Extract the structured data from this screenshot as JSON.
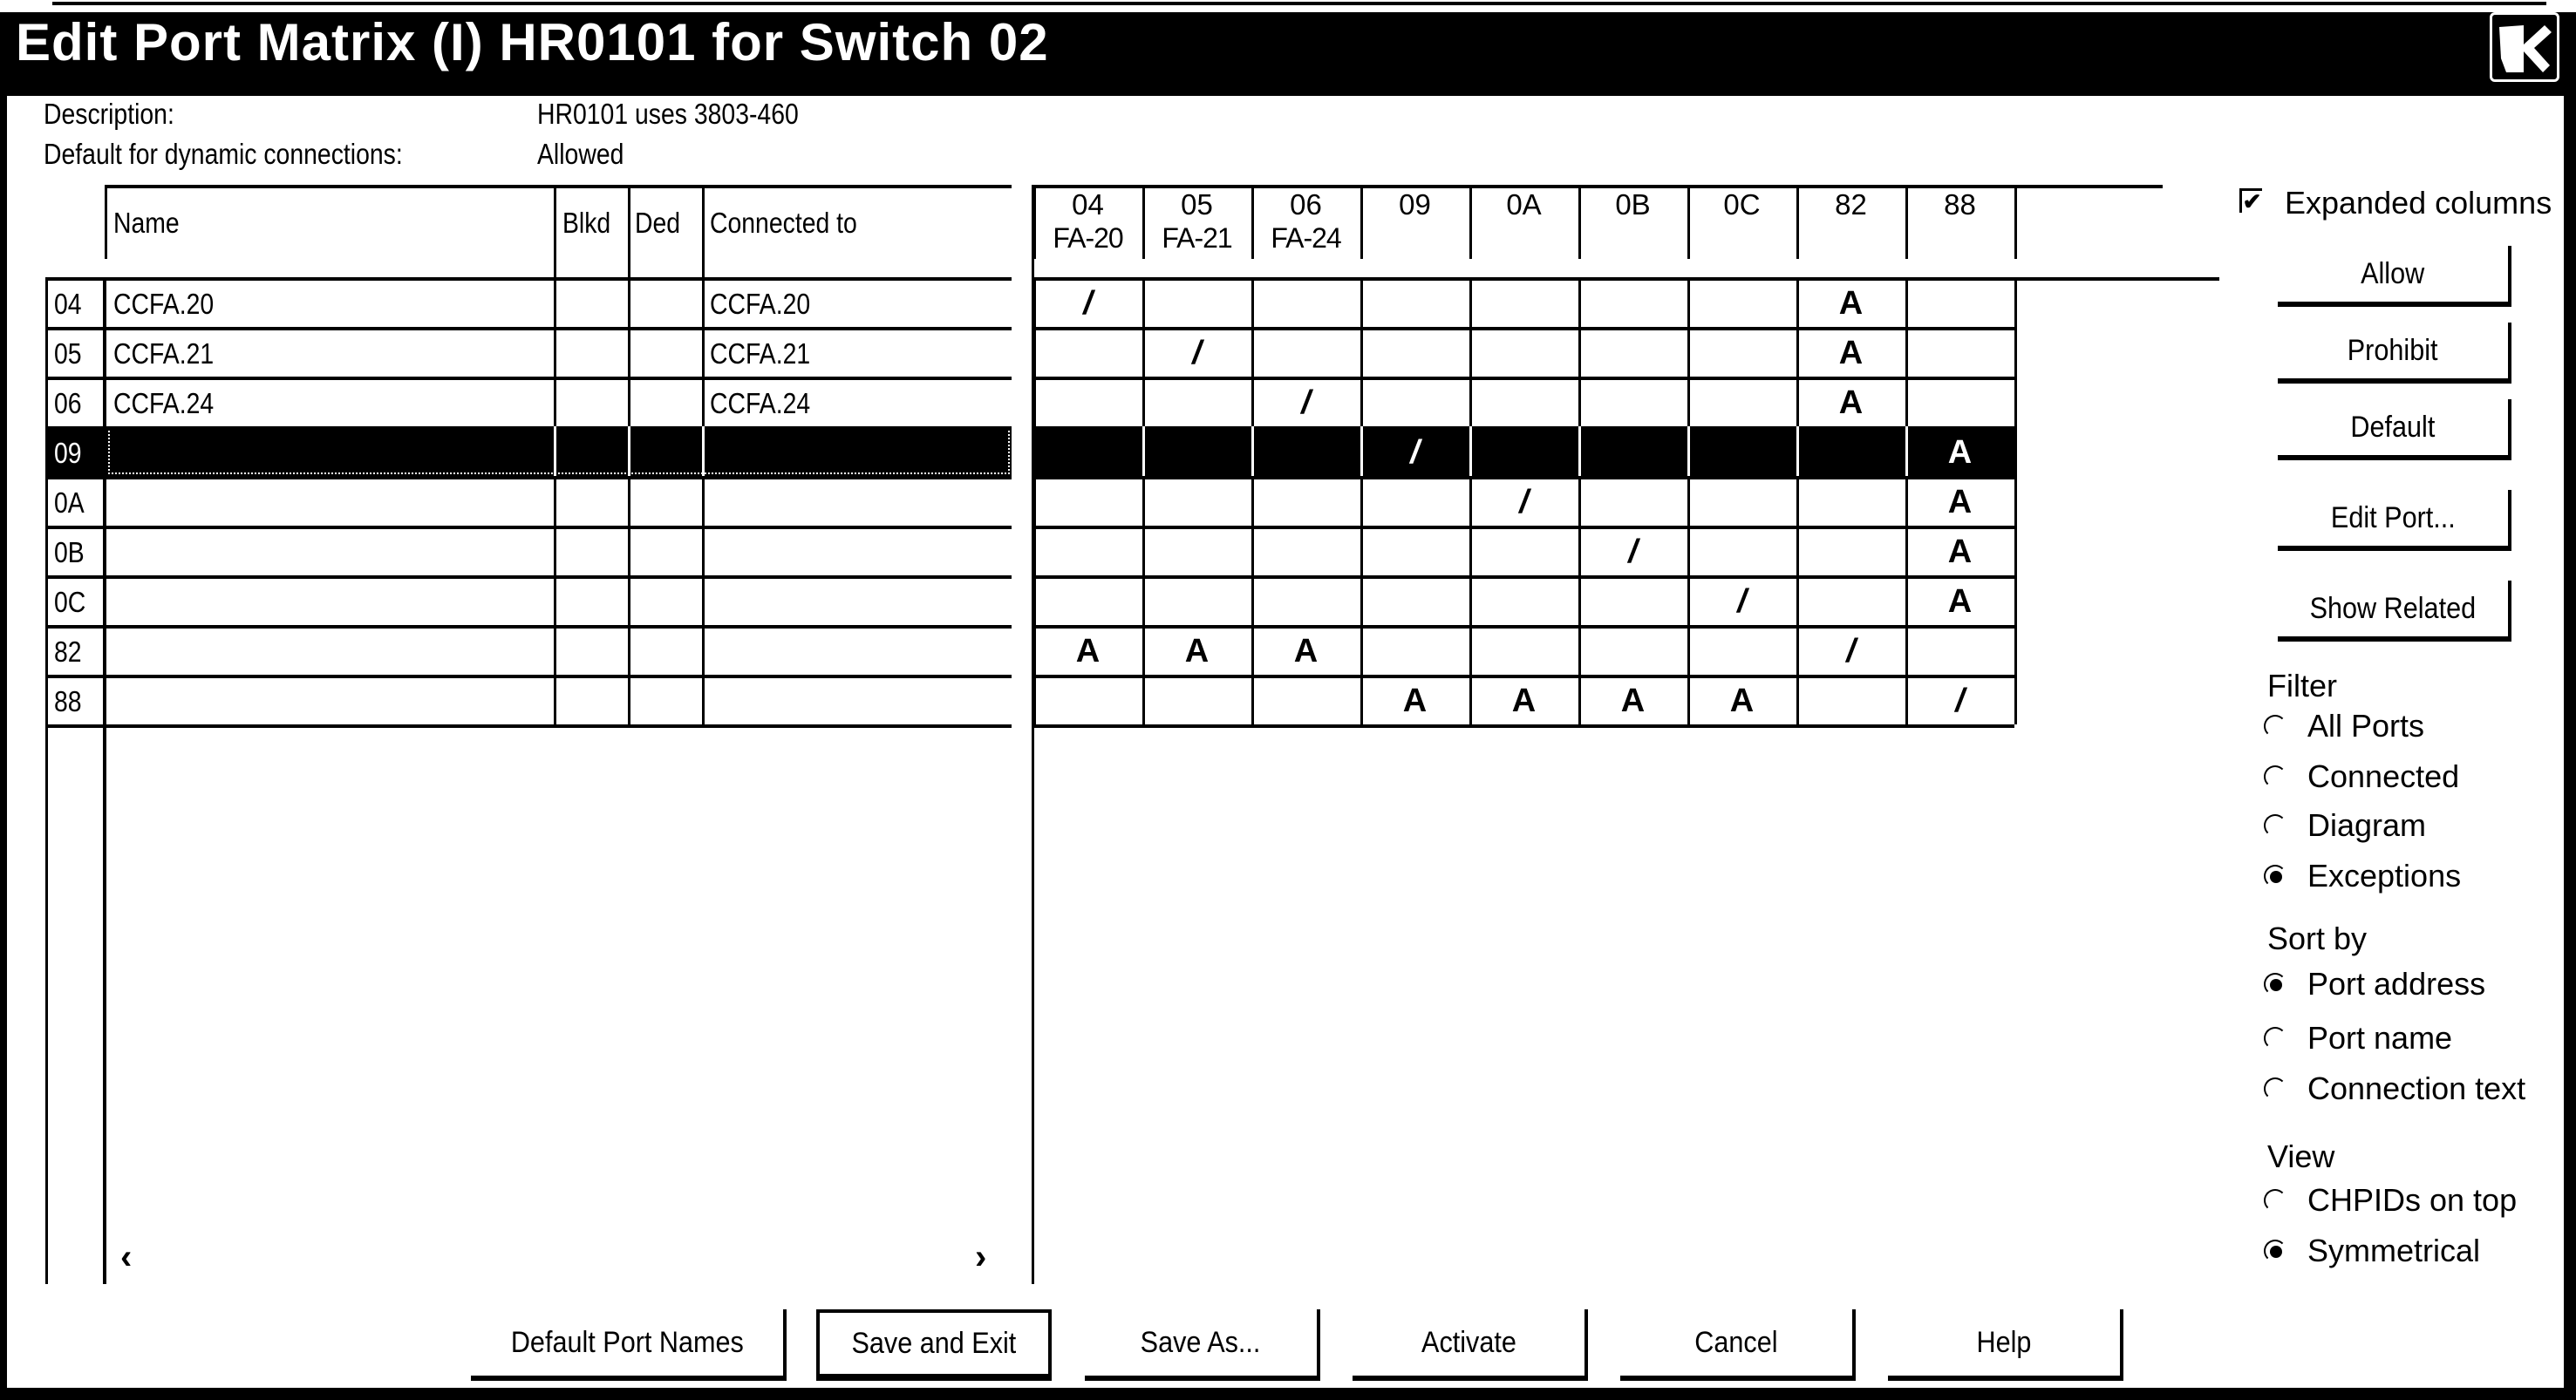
{
  "window": {
    "title": "Edit Port Matrix (I) HR0101 for Switch 02",
    "close_icon": "close-icon"
  },
  "info": {
    "description_label": "Description:",
    "description_value": "HR0101 uses 3803-460",
    "default_label": "Default for dynamic connections:",
    "default_value": "Allowed"
  },
  "port_table": {
    "columns": {
      "name": "Name",
      "blkd": "Blkd",
      "ded": "Ded",
      "connected": "Connected to"
    },
    "selected_row": "09",
    "rows": [
      {
        "addr": "04",
        "name": "CCFA.20",
        "blkd": "",
        "ded": "",
        "connected": "CCFA.20"
      },
      {
        "addr": "05",
        "name": "CCFA.21",
        "blkd": "",
        "ded": "",
        "connected": "CCFA.21"
      },
      {
        "addr": "06",
        "name": "CCFA.24",
        "blkd": "",
        "ded": "",
        "connected": "CCFA.24"
      },
      {
        "addr": "09",
        "name": "",
        "blkd": "",
        "ded": "",
        "connected": ""
      },
      {
        "addr": "0A",
        "name": "",
        "blkd": "",
        "ded": "",
        "connected": ""
      },
      {
        "addr": "0B",
        "name": "",
        "blkd": "",
        "ded": "",
        "connected": ""
      },
      {
        "addr": "0C",
        "name": "",
        "blkd": "",
        "ded": "",
        "connected": ""
      },
      {
        "addr": "82",
        "name": "",
        "blkd": "",
        "ded": "",
        "connected": ""
      },
      {
        "addr": "88",
        "name": "",
        "blkd": "",
        "ded": "",
        "connected": ""
      }
    ],
    "scroll_left": "‹",
    "scroll_right": "›"
  },
  "matrix": {
    "columns": [
      {
        "addr": "04",
        "sub": "FA-20"
      },
      {
        "addr": "05",
        "sub": "FA-21"
      },
      {
        "addr": "06",
        "sub": "FA-24"
      },
      {
        "addr": "09",
        "sub": ""
      },
      {
        "addr": "0A",
        "sub": ""
      },
      {
        "addr": "0B",
        "sub": ""
      },
      {
        "addr": "0C",
        "sub": ""
      },
      {
        "addr": "82",
        "sub": ""
      },
      {
        "addr": "88",
        "sub": ""
      }
    ],
    "cells": [
      [
        "/",
        "",
        "",
        "",
        "",
        "",
        "",
        "A",
        ""
      ],
      [
        "",
        "/",
        "",
        "",
        "",
        "",
        "",
        "A",
        ""
      ],
      [
        "",
        "",
        "/",
        "",
        "",
        "",
        "",
        "A",
        ""
      ],
      [
        "",
        "",
        "",
        "/",
        "",
        "",
        "",
        "",
        "A"
      ],
      [
        "",
        "",
        "",
        "",
        "/",
        "",
        "",
        "",
        "A"
      ],
      [
        "",
        "",
        "",
        "",
        "",
        "/",
        "",
        "",
        "A"
      ],
      [
        "",
        "",
        "",
        "",
        "",
        "",
        "/",
        "",
        "A"
      ],
      [
        "A",
        "A",
        "A",
        "",
        "",
        "",
        "",
        "/",
        ""
      ],
      [
        "",
        "",
        "",
        "A",
        "A",
        "A",
        "A",
        "",
        "/"
      ]
    ]
  },
  "side_panel": {
    "expanded_columns": {
      "label": "Expanded columns",
      "checked": true
    },
    "buttons": [
      "Allow",
      "Prohibit",
      "Default",
      "Edit Port...",
      "Show Related"
    ],
    "filter": {
      "label": "Filter",
      "options": [
        "All Ports",
        "Connected",
        "Diagram",
        "Exceptions"
      ],
      "selected": "Exceptions"
    },
    "sort_by": {
      "label": "Sort by",
      "options": [
        "Port address",
        "Port name",
        "Connection text"
      ],
      "selected": "Port address"
    },
    "view": {
      "label": "View",
      "options": [
        "CHPIDs on top",
        "Symmetrical"
      ],
      "selected": "Symmetrical"
    }
  },
  "footer_buttons": [
    "Default Port Names",
    "Save and Exit",
    "Save As...",
    "Activate",
    "Cancel",
    "Help"
  ],
  "footer_default": "Save and Exit"
}
